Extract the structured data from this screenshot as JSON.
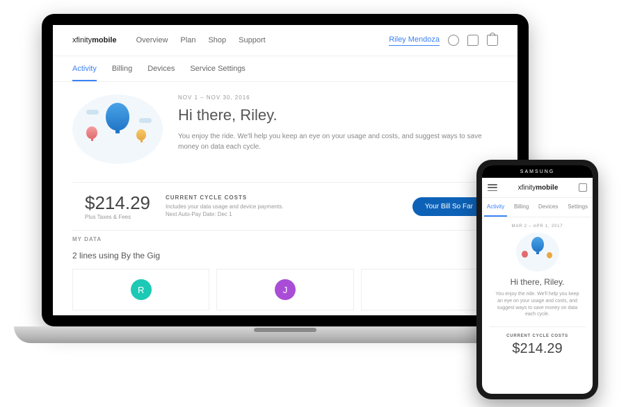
{
  "logo_prefix": "xfinity",
  "logo_suffix": "mobile",
  "desktop": {
    "nav": [
      "Overview",
      "Plan",
      "Shop",
      "Support"
    ],
    "user_name": "Riley Mendoza",
    "tabs": [
      "Activity",
      "Billing",
      "Devices",
      "Service Settings"
    ],
    "date_range": "NOV 1 – NOV 30, 2016",
    "greeting": "Hi there, Riley.",
    "subtext": "You enjoy the ride. We'll help you keep an eye on your usage and costs, and suggest ways to save money on data each cycle.",
    "cost": {
      "amount": "$214.29",
      "tax_label": "Plus Taxes & Fees",
      "title": "CURRENT CYCLE COSTS",
      "detail1": "Includes your data usage and device payments.",
      "detail2": "Next Auto-Pay Date: Dec 1",
      "button_label": "Your Bill So Far"
    },
    "mydata_header": "MY DATA",
    "lines_title": "2 lines using By the Gig",
    "lines": [
      {
        "initial": "R"
      },
      {
        "initial": "J"
      }
    ]
  },
  "phone": {
    "brand": "SAMSUNG",
    "tabs": [
      "Activity",
      "Billing",
      "Devices",
      "Settings"
    ],
    "date_range": "MAR 2 – APR 1, 2017",
    "greeting": "Hi there, Riley.",
    "subtext": "You enjoy the ride. We'll help you keep an eye on your usage and costs, and suggest ways to save money on data each cycle.",
    "cost_title": "CURRENT CYCLE COSTS",
    "amount": "$214.29"
  }
}
